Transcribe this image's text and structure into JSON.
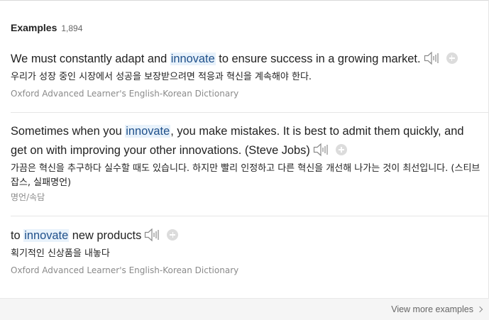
{
  "header": {
    "title": "Examples",
    "count": "1,894"
  },
  "examples": [
    {
      "en_before": "We must constantly adapt and ",
      "keyword": "innovate",
      "en_after": " to ensure success in a growing market.",
      "ko": "우리가 성장 중인 시장에서 성공을 보장받으려면 적응과 혁신을 계속해야 한다.",
      "source": "Oxford Advanced Learner's English-Korean Dictionary"
    },
    {
      "en_before": "Sometimes when you ",
      "keyword": "innovate",
      "en_after": ", you make mistakes. It is best to admit them quickly, and get on with improving your other innovations. (Steve Jobs)",
      "ko": "가끔은 혁신을 추구하다 실수할 때도 있습니다. 하지만 빨리 인정하고 다른 혁신을 개선해 나가는 것이 최선입니다. (스티브 잡스, 실패명언)",
      "source": "명언/속담"
    },
    {
      "en_before": "to ",
      "keyword": "innovate",
      "en_after": " new products",
      "ko": "획기적인 신상품을 내놓다",
      "source": "Oxford Advanced Learner's English-Korean Dictionary"
    }
  ],
  "footer": {
    "more_label": "View more examples"
  },
  "icons": {
    "speaker": "speaker-icon",
    "add": "plus-circle-icon",
    "chevron": "chevron-right-icon"
  },
  "colors": {
    "highlight_bg": "#e8f2fb",
    "keyword": "#1e4f8a",
    "source": "#8a8a8a"
  }
}
